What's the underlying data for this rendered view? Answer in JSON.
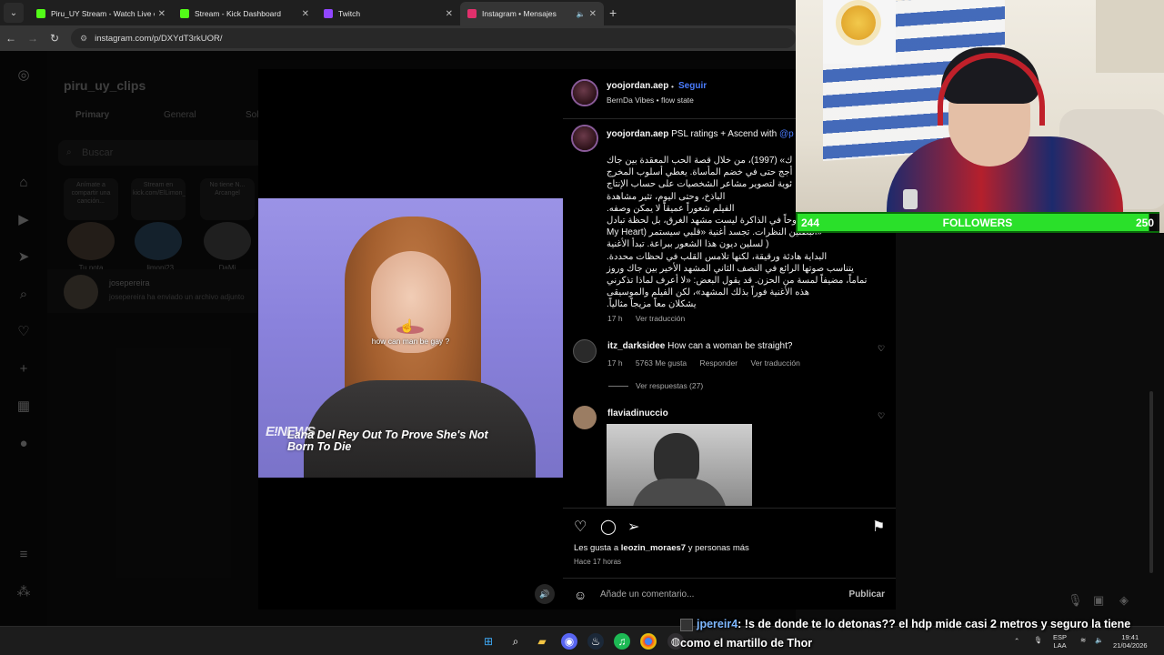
{
  "browser": {
    "tabs": [
      {
        "label": "Piru_UY Stream - Watch Live on",
        "favicon_color": "#53fc18"
      },
      {
        "label": "Stream - Kick Dashboard",
        "favicon_color": "#53fc18"
      },
      {
        "label": "Twitch",
        "favicon_color": "#9146ff"
      },
      {
        "label": "Instagram • Mensajes",
        "favicon_color": "#e1306c"
      }
    ],
    "url": "instagram.com/p/DXYdT3rkUOR/"
  },
  "dm_panel": {
    "username": "piru_uy_clips",
    "tabs": [
      "Primary",
      "General",
      "Sol"
    ],
    "search_placeholder": "Buscar",
    "notes": [
      {
        "bubble": "Anímate a compartir una canción...",
        "name": "Tu nota"
      },
      {
        "bubble": "Stream en kick.com/ElLimon_i23",
        "name": "_limoni23"
      },
      {
        "bubble": "No tiene N... Arcangel",
        "name": "DaMi"
      }
    ],
    "thread": {
      "name": "josepereira",
      "message": "josepereira ha enviado un archivo adjunto"
    }
  },
  "post": {
    "author": "yoojordan.aep",
    "follow_label": "Seguir",
    "music": "BernDa Vibes • flow state",
    "caption_prefix": "PSL ratings + Ascend with",
    "caption_mention": "@p",
    "caption_arabic": [
      "ك» (1997)، من خلال قصة الحب المعقدة بين جاك",
      "أجج حتى في خضم المأساة. يعطي أسلوب المخرج",
      "ئوية لتصوير مشاعر الشخصيات على حساب الإنتاج",
      "الباذخ، وحتى اليوم، تثير مشاهدة",
      "الفيلم شعوراً عميقاً لا يمكن وصفه.",
      "وحاً في الذاكرة ليست مشهد الغرق، بل لحظة تبادل",
      "«البطلين النظرات. تجسد أغنية «قلبي سيستمر (My Heart",
      "( لسلين ديون هذا الشعور ببراعة. تبدأ الأغنية",
      "البداية هادئة ورقيقة، لكنها تلامس القلب في لحظات محددة.",
      "يتناسب صوتها الرائع في النصف الثاني المشهد الأخير بين جاك وروز",
      "تماماً، مضيفاً لمسة من الحزن. قد يقول البعض: «لا أعرف لماذا تذكرني",
      "هذه الأغنية فوراً بذلك المشهد»، لكن الفيلم والموسيقى",
      "يشكلان معاً مزيجاً مثالياً."
    ],
    "caption_time": "17 h",
    "translate_label": "Ver traducción",
    "video_subtitle": "how can man be gay ?",
    "video_logo": "E!NEWS",
    "video_headline_1": "Lana Del Rey Out To Prove She's Not",
    "video_headline_2": "Born To Die",
    "comments": [
      {
        "user": "itz_darksidee",
        "text": "How can a woman be straight?",
        "time": "17 h",
        "likes": "5763 Me gusta",
        "reply": "Responder",
        "translate": "Ver traducción",
        "replies": "Ver respuestas (27)"
      },
      {
        "user": "flaviadinuccio",
        "text": ""
      }
    ],
    "liked_by_prefix": "Les gusta a",
    "liked_by_user": "leozin_moraes7",
    "liked_by_suffix": "y personas más",
    "posted_ago": "Hace 17 horas",
    "comment_placeholder": "Añade un comentario...",
    "publish_label": "Publicar"
  },
  "overlay": {
    "followers_current": "244",
    "followers_label": "FOLLOWERS",
    "followers_goal": "250",
    "followers_progress": 0.976,
    "chat_user": "jpereir4",
    "chat_message": ": !s de donde te lo detonas?? el hdp mide casi 2 metros y seguro la tiene como el martillo de Thor"
  },
  "taskbar": {
    "lang_1": "ESP",
    "lang_2": "LAA",
    "time": "19:41",
    "date": "21/04/2026",
    "notification_count": "99+"
  },
  "colors": {
    "accent_link": "#4a7cff",
    "followers_bar": "#2ae02a",
    "chat_username": "#7fb8ff"
  },
  "icons": [
    "instagram-icon",
    "home-icon",
    "reels-icon",
    "send-icon",
    "search-icon",
    "heart-icon",
    "plus-icon",
    "stats-icon",
    "menu-icon",
    "apps-icon",
    "bookmark-icon",
    "comment-icon",
    "share-icon",
    "volume-icon"
  ]
}
